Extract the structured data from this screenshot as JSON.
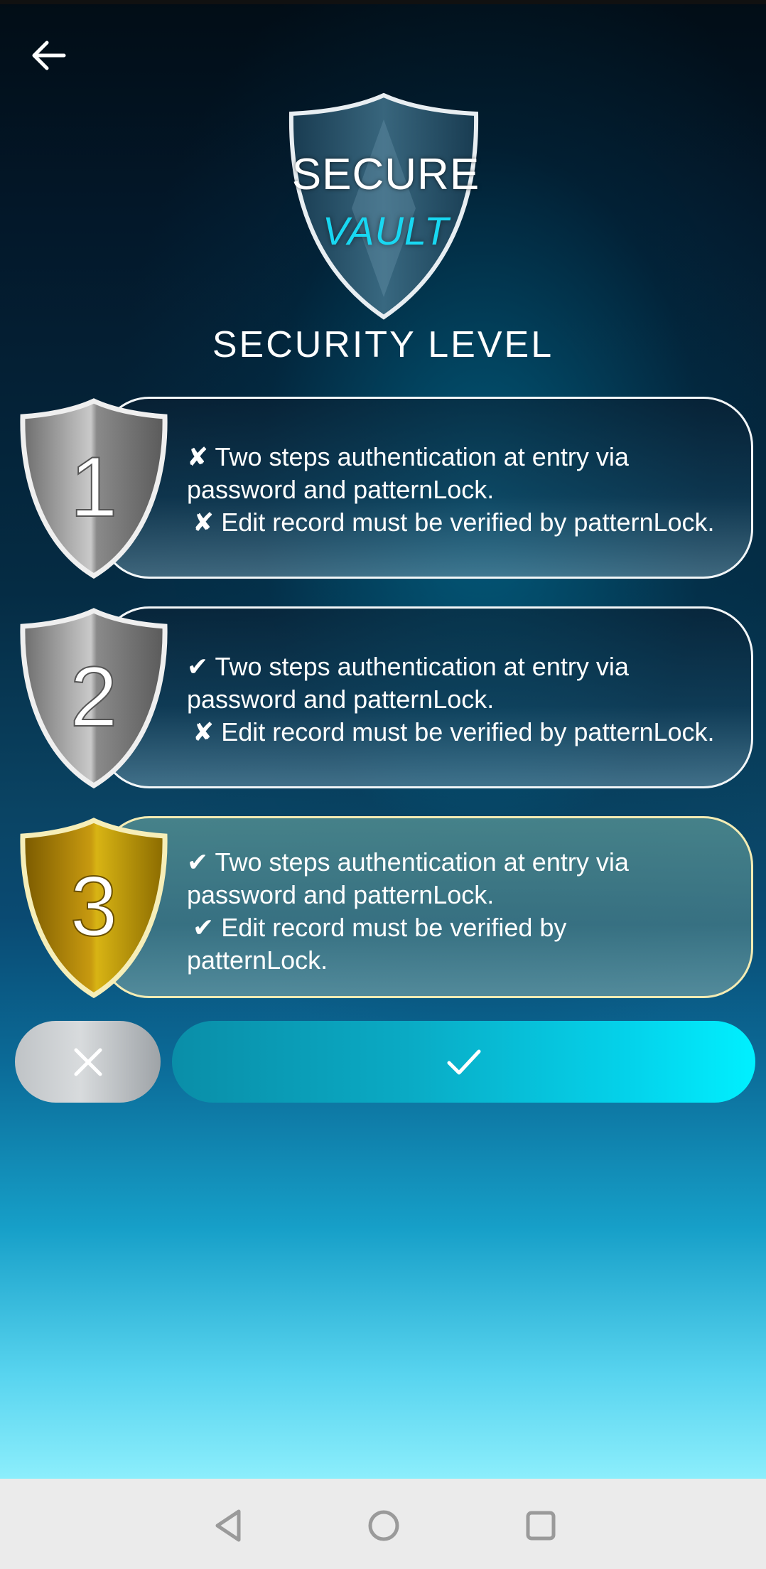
{
  "header": {
    "back_icon": "arrow-left-icon",
    "logo_line1": "SECURE",
    "logo_line2": "VAULT",
    "title": "SECURITY LEVEL"
  },
  "levels": [
    {
      "number": "1",
      "color": "silver",
      "line1_mark": "✘",
      "line1_a": "Two steps authentication at entry via",
      "line1_b": "password and patternLock.",
      "line2_mark": "✘",
      "line2_a": "Edit record must be verified by patternLock.",
      "line2_b": ""
    },
    {
      "number": "2",
      "color": "silver",
      "line1_mark": "✔",
      "line1_a": "Two steps authentication at entry via",
      "line1_b": "password and patternLock.",
      "line2_mark": "✘",
      "line2_a": "Edit record must be verified by patternLock.",
      "line2_b": ""
    },
    {
      "number": "3",
      "color": "gold",
      "line1_mark": "✔",
      "line1_a": "Two steps authentication at entry via",
      "line1_b": "password and patternLock.",
      "line2_mark": "✔",
      "line2_a": "Edit record must be verified by",
      "line2_b": "patternLock."
    }
  ],
  "actions": {
    "cancel_icon": "close-icon",
    "confirm_icon": "checkmark-icon"
  },
  "navbar": {
    "back": "nav-back-icon",
    "home": "nav-home-icon",
    "recents": "nav-recents-icon"
  },
  "colors": {
    "accent": "#00f0ff",
    "gold": "#d4ac14",
    "silver": "#b8b8b8"
  }
}
